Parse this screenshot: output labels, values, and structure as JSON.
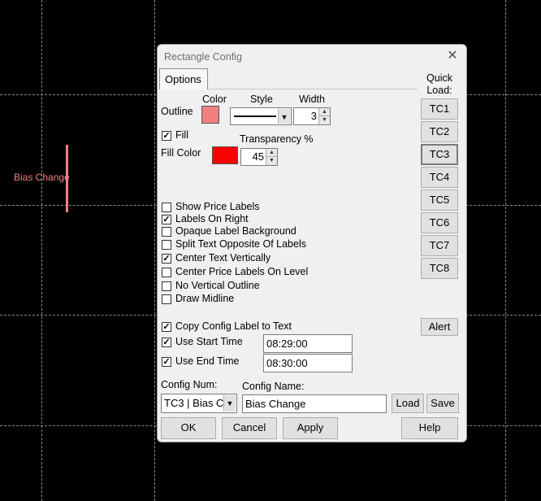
{
  "chart": {
    "label": "Bias Change",
    "line_color": "#f08080"
  },
  "dialog": {
    "title": "Rectangle Config",
    "close_glyph": "✕",
    "tab_options": "Options",
    "headers": {
      "color": "Color",
      "style": "Style",
      "width": "Width"
    },
    "outline": {
      "label": "Outline",
      "color": "#f08080",
      "width": "3"
    },
    "fill": {
      "label": "Fill",
      "checked": true,
      "color_label": "Fill Color",
      "color": "#ff0000"
    },
    "transparency": {
      "label": "Transparency %",
      "value": "45"
    },
    "checkboxes": [
      {
        "label": "Show Price Labels",
        "checked": false
      },
      {
        "label": "Labels On Right",
        "checked": true
      },
      {
        "label": "Opaque Label Background",
        "checked": false
      },
      {
        "label": "Split Text Opposite Of Labels",
        "checked": false
      },
      {
        "label": "Center Text Vertically",
        "checked": true
      },
      {
        "label": "Center Price Labels On Level",
        "checked": false
      },
      {
        "label": "No Vertical Outline",
        "checked": false
      },
      {
        "label": "Draw Midline",
        "checked": false
      }
    ],
    "copy_label": {
      "label": "Copy Config Label to Text",
      "checked": true
    },
    "start_time": {
      "label": "Use Start Time",
      "checked": true,
      "value": "08:29:00"
    },
    "end_time": {
      "label": "Use End Time",
      "checked": true,
      "value": "08:30:00"
    },
    "quick_load": {
      "label": "Quick Load:",
      "buttons": [
        "TC1",
        "TC2",
        "TC3",
        "TC4",
        "TC5",
        "TC6",
        "TC7",
        "TC8"
      ],
      "selected": "TC3"
    },
    "alert_button": "Alert",
    "config_num": {
      "label": "Config Num:",
      "value": "TC3 | Bias C"
    },
    "config_name": {
      "label": "Config Name:",
      "value": "Bias Change"
    },
    "buttons": {
      "load": "Load",
      "save": "Save",
      "ok": "OK",
      "cancel": "Cancel",
      "apply": "Apply",
      "help": "Help"
    }
  }
}
